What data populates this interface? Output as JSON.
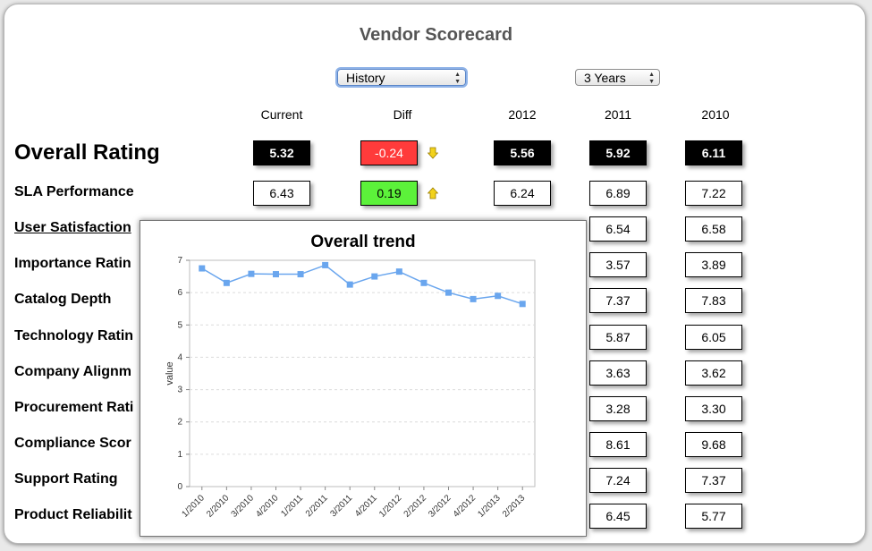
{
  "page": {
    "title": "Vendor Scorecard"
  },
  "controls": {
    "view_select": {
      "value": "History"
    },
    "range_select": {
      "value": "3 Years"
    }
  },
  "columns": [
    "Current",
    "Diff",
    "2012",
    "2011",
    "2010"
  ],
  "rows": [
    {
      "label": "Overall Rating",
      "current": "5.32",
      "diff": "-0.24",
      "diff_direction": "down",
      "y2012": "5.56",
      "y2011": "5.92",
      "y2010": "6.11",
      "emphasis": true
    },
    {
      "label": "SLA Performance",
      "current": "6.43",
      "diff": "0.19",
      "diff_direction": "up",
      "y2012": "6.24",
      "y2011": "6.89",
      "y2010": "7.22"
    },
    {
      "label": "User Satisfaction",
      "y2011": "6.54",
      "y2010": "6.58",
      "link": true
    },
    {
      "label": "Importance Ratin",
      "y2011": "3.57",
      "y2010": "3.89"
    },
    {
      "label": "Catalog Depth",
      "y2011": "7.37",
      "y2010": "7.83"
    },
    {
      "label": "Technology Ratin",
      "y2011": "5.87",
      "y2010": "6.05"
    },
    {
      "label": "Company Alignm",
      "y2011": "3.63",
      "y2010": "3.62"
    },
    {
      "label": "Procurement Rati",
      "y2011": "3.28",
      "y2010": "3.30"
    },
    {
      "label": "Compliance Scor",
      "y2011": "8.61",
      "y2010": "9.68"
    },
    {
      "label": "Support Rating",
      "y2011": "7.24",
      "y2010": "7.37"
    },
    {
      "label": "Product Reliabilit",
      "y2011": "6.45",
      "y2010": "5.77"
    }
  ],
  "colors": {
    "negative": "#ff3b3b",
    "positive": "#5cf23a",
    "arrow": "#f2d21b",
    "series": "#6aa6ee"
  },
  "icons": {
    "down": "arrow-down-icon",
    "up": "arrow-up-icon"
  },
  "popup": {
    "title": "Overall trend",
    "chart_data": {
      "type": "line",
      "title": "Overall trend",
      "xlabel": "",
      "ylabel": "value",
      "categories": [
        "1/2010",
        "2/2010",
        "3/2010",
        "4/2010",
        "1/2011",
        "2/2011",
        "3/2011",
        "4/2011",
        "1/2012",
        "2/2012",
        "3/2012",
        "4/2012",
        "1/2013",
        "2/2013"
      ],
      "values": [
        6.75,
        6.3,
        6.58,
        6.57,
        6.57,
        6.85,
        6.25,
        6.5,
        6.65,
        6.3,
        6.0,
        5.8,
        5.9,
        5.65
      ],
      "ylim": [
        0,
        7
      ],
      "yticks": [
        0,
        1,
        2,
        3,
        4,
        5,
        6,
        7
      ],
      "grid": true,
      "legend": "none"
    }
  }
}
